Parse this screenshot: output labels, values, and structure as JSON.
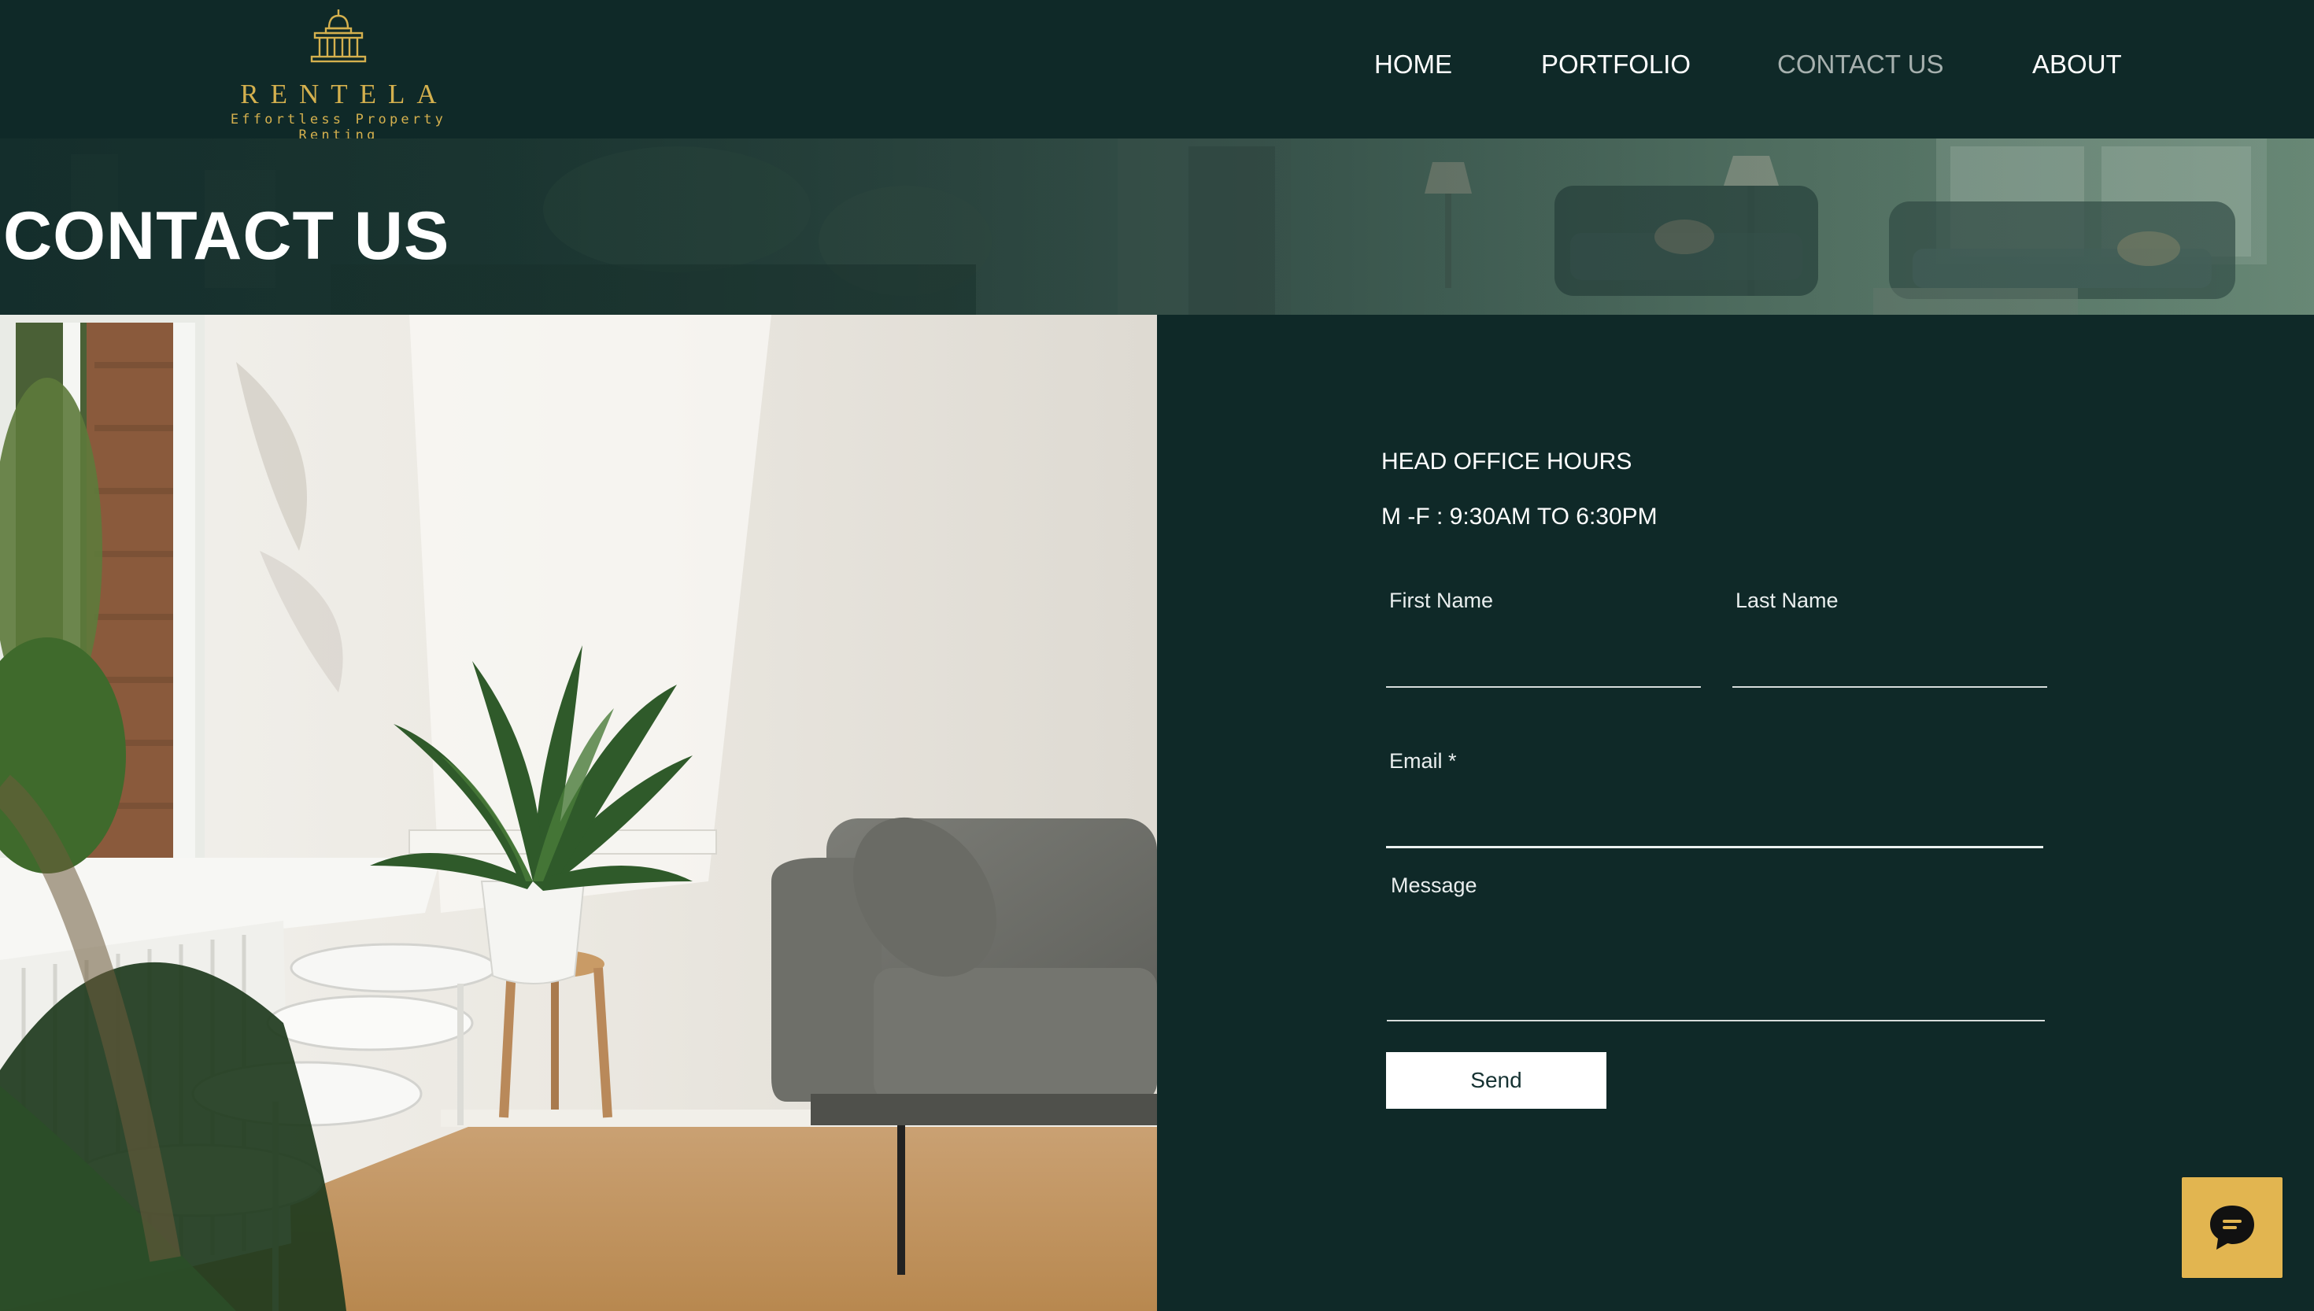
{
  "brand": {
    "name": "RENTELA",
    "tagline": "Effortless Property Renting",
    "gold": "#d4b04e"
  },
  "nav": {
    "items": [
      {
        "label": "HOME",
        "active": false
      },
      {
        "label": "PORTFOLIO",
        "active": false
      },
      {
        "label": "CONTACT US",
        "active": true
      },
      {
        "label": "ABOUT",
        "active": false
      }
    ]
  },
  "hero": {
    "title": "CONTACT US"
  },
  "contact": {
    "hours_title": "HEAD OFFICE HOURS",
    "hours_text": "M -F : 9:30AM TO 6:30PM",
    "form": {
      "first_name_label": "First Name",
      "first_name_value": "",
      "last_name_label": "Last Name",
      "last_name_value": "",
      "email_label": "Email *",
      "email_value": "",
      "message_label": "Message",
      "message_value": "",
      "send_label": "Send"
    }
  },
  "chat": {
    "icon": "chat-bubble-icon",
    "color": "#e2b550"
  },
  "colors": {
    "background": "#0f2928",
    "active_nav": "#a6b0ae",
    "text": "#ffffff"
  }
}
